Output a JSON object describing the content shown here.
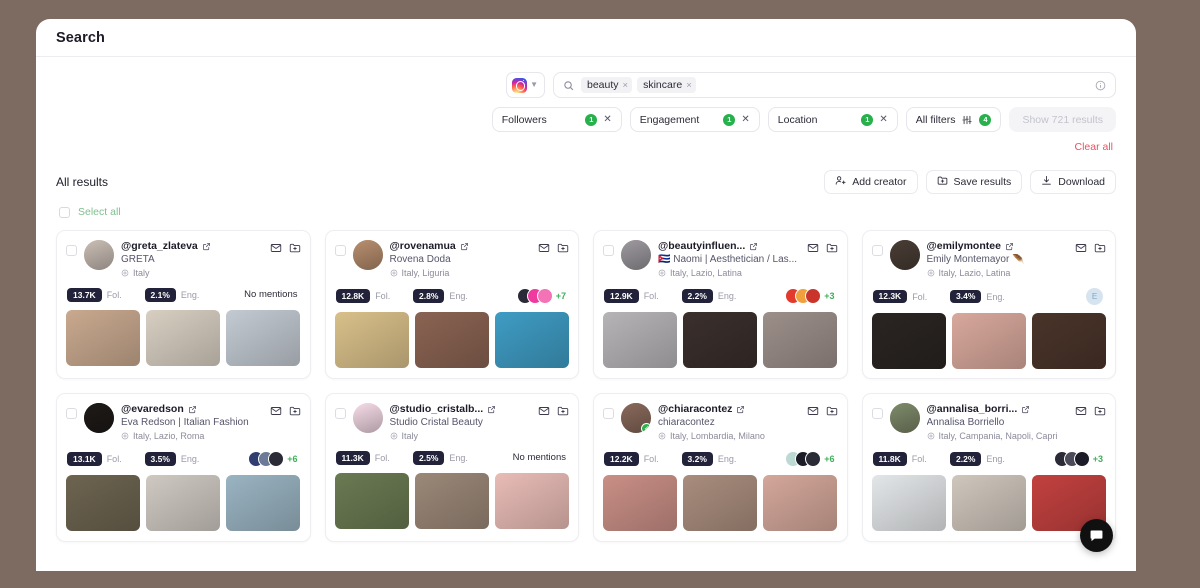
{
  "window": {
    "title": "Search"
  },
  "search": {
    "platform_icon": "instagram-icon",
    "tags": [
      {
        "label": "beauty",
        "remove": "×"
      },
      {
        "label": "skincare",
        "remove": "×"
      }
    ],
    "info_icon": "info-circle-icon"
  },
  "filters": {
    "chips": [
      {
        "label": "Followers",
        "badge": "1",
        "remove": "✕"
      },
      {
        "label": "Engagement",
        "badge": "1",
        "remove": "✕"
      },
      {
        "label": "Location",
        "badge": "1",
        "remove": "✕"
      }
    ],
    "all_filters": {
      "label": "All filters",
      "badge": "4",
      "icon": "sliders-icon"
    },
    "show_results": "Show 721 results",
    "clear_all": "Clear all"
  },
  "results": {
    "heading": "All results",
    "select_all": "Select all",
    "actions": [
      {
        "label": "Add creator",
        "icon": "add-user-icon"
      },
      {
        "label": "Save results",
        "icon": "folder-plus-icon"
      },
      {
        "label": "Download",
        "icon": "download-icon"
      }
    ],
    "stat_labels": {
      "followers": "Fol.",
      "engagement": "Eng."
    },
    "no_mentions": "No mentions",
    "cards": [
      {
        "handle": "@greta_zlateva",
        "name": "GRETA",
        "location": "Italy",
        "followers": "13.7K",
        "engagement": "2.1%",
        "mentions": {
          "type": "none",
          "text": "No mentions"
        },
        "verified": false,
        "avatar_color": "#cbbfb6",
        "thumbs": [
          "#c9a98f",
          "#d8cfc2",
          "#c3cad2"
        ]
      },
      {
        "handle": "@rovenamua",
        "name": "Rovena Doda",
        "location": "Italy, Liguria",
        "followers": "12.8K",
        "engagement": "2.8%",
        "mentions": {
          "type": "stack",
          "count": "+7",
          "colors": [
            "#2b2b38",
            "#ef3ba0",
            "#f472b6"
          ]
        },
        "verified": false,
        "avatar_color": "#b98f6f",
        "thumbs": [
          "#d9c08a",
          "#8a6352",
          "#3f9cc4"
        ]
      },
      {
        "handle": "@beautyinfluen...",
        "name": "🇨🇺 Naomi | Aesthetician / Las...",
        "location": "Italy, Lazio, Latina",
        "followers": "12.9K",
        "engagement": "2.2%",
        "mentions": {
          "type": "stack",
          "count": "+3",
          "colors": [
            "#e23b2e",
            "#f0a03c",
            "#c9352b"
          ]
        },
        "verified": false,
        "avatar_color": "#9e9aa0",
        "thumbs": [
          "#b6b4b7",
          "#3a2f2c",
          "#9c8f8a"
        ]
      },
      {
        "handle": "@emilymontee",
        "name": "Emily Montemayor 🪶",
        "location": "Italy, Lazio, Latina",
        "followers": "12.3K",
        "engagement": "3.4%",
        "mentions": {
          "type": "single",
          "letter": "E"
        },
        "verified": false,
        "avatar_color": "#4a3e36",
        "thumbs": [
          "#2a2522",
          "#d8a89c",
          "#4a342a"
        ]
      },
      {
        "handle": "@evaredson",
        "name": "Eva Redson | Italian Fashion",
        "location": "Italy, Lazio, Roma",
        "followers": "13.1K",
        "engagement": "3.5%",
        "mentions": {
          "type": "stack",
          "count": "+6",
          "colors": [
            "#2f3d70",
            "#6b7a96",
            "#2b2b38"
          ]
        },
        "verified": false,
        "avatar_color": "#1e1a18",
        "thumbs": [
          "#6d6450",
          "#cfc9c2",
          "#9ab4c2"
        ]
      },
      {
        "handle": "@studio_cristalb...",
        "name": "Studio Cristal Beauty",
        "location": "Italy",
        "followers": "11.3K",
        "engagement": "2.5%",
        "mentions": {
          "type": "none",
          "text": "No mentions"
        },
        "verified": false,
        "avatar_color": "#f7dce8",
        "thumbs": [
          "#6a7a52",
          "#9b8878",
          "#e9bcb6"
        ]
      },
      {
        "handle": "@chiaracontez",
        "name": "chiaracontez",
        "location": "Italy, Lombardia, Milano",
        "followers": "12.2K",
        "engagement": "3.2%",
        "mentions": {
          "type": "stack",
          "count": "+6",
          "colors": [
            "#bcd9d4",
            "#1c1c28",
            "#2b2b38"
          ]
        },
        "verified": true,
        "avatar_color": "#8a6a5c",
        "thumbs": [
          "#c98f86",
          "#a98d7d",
          "#d4a79a"
        ]
      },
      {
        "handle": "@annalisa_borri...",
        "name": "Annalisa Borriello",
        "location": "Italy, Campania, Napoli, Capri",
        "followers": "11.8K",
        "engagement": "2.2%",
        "mentions": {
          "type": "stack",
          "count": "+3",
          "colors": [
            "#2b2b38",
            "#4a4a58",
            "#1c1c28"
          ]
        },
        "verified": false,
        "avatar_color": "#7f8a6a",
        "thumbs": [
          "#e3e6e8",
          "#cfc6bc",
          "#c2413f"
        ]
      }
    ]
  },
  "chat_widget": {
    "icon": "chat-bubble-icon"
  },
  "colors": {
    "accent_green": "#27b04b",
    "clear_all_red": "#e8535f",
    "pill_dark": "#22223a",
    "page_background": "#7d6a60"
  }
}
